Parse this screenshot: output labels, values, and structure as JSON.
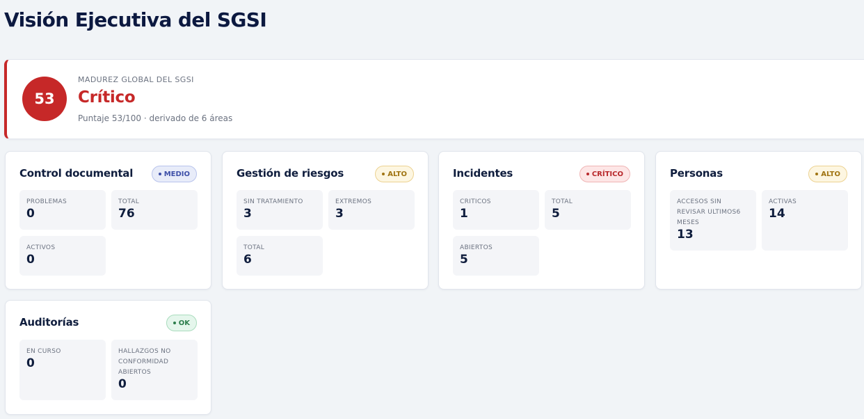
{
  "page": {
    "title": "Visión Ejecutiva del SGSI"
  },
  "maturity": {
    "score": "53",
    "label": "MADUREZ GLOBAL DEL SGSI",
    "status": "Crítico",
    "description": "Puntaje 53/100 · derivado de 6 áreas",
    "color": "#c62828"
  },
  "cards": [
    {
      "title": "Control documental",
      "badge": "MEDIO",
      "metrics": [
        {
          "label": "PROBLEMAS",
          "value": "0"
        },
        {
          "label": "TOTAL",
          "value": "76"
        },
        {
          "label": "ACTIVOS",
          "value": "0"
        }
      ]
    },
    {
      "title": "Gestión de riesgos",
      "badge": "ALTO",
      "metrics": [
        {
          "label": "SIN TRATAMIENTO",
          "value": "3"
        },
        {
          "label": "EXTREMOS",
          "value": "3"
        },
        {
          "label": "TOTAL",
          "value": "6"
        }
      ]
    },
    {
      "title": "Incidentes",
      "badge": "CRÍTICO",
      "metrics": [
        {
          "label": "CRITICOS",
          "value": "1"
        },
        {
          "label": "TOTAL",
          "value": "5"
        },
        {
          "label": "ABIERTOS",
          "value": "5"
        }
      ]
    },
    {
      "title": "Personas",
      "badge": "ALTO",
      "metrics": [
        {
          "label": "ACCESOS SIN REVISAR ULTIMOS6 MESES",
          "value": "13"
        },
        {
          "label": "ACTIVAS",
          "value": "14"
        }
      ]
    },
    {
      "title": "Auditorías",
      "badge": "OK",
      "metrics": [
        {
          "label": "EN CURSO",
          "value": "0"
        },
        {
          "label": "HALLAZGOS NO CONFORMIDAD ABIERTOS",
          "value": "0"
        }
      ]
    }
  ],
  "colors": {
    "critico": "#c62828",
    "medio": "#3d4fa8",
    "alto": "#a07412",
    "ok": "#2c7d4b"
  }
}
